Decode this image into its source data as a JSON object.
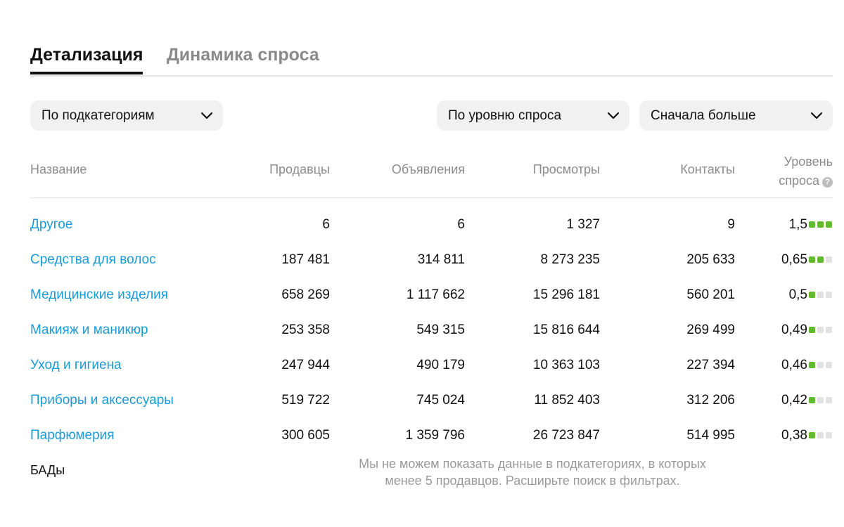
{
  "tabs": [
    {
      "label": "Детализация",
      "active": true
    },
    {
      "label": "Динамика спроса",
      "active": false
    }
  ],
  "filters": {
    "grouping": "По подкатегориям",
    "metric": "По уровню спроса",
    "sort": "Сначала больше"
  },
  "table": {
    "headers": {
      "name": "Название",
      "sellers": "Продавцы",
      "listings": "Объявления",
      "views": "Просмотры",
      "contacts": "Контакты",
      "level": "Уровень спроса"
    },
    "rows": [
      {
        "name": "Другое",
        "sellers": "6",
        "listings": "6",
        "views": "1 327",
        "contacts": "9",
        "level": "1,5",
        "level_dots": 3
      },
      {
        "name": "Средства для волос",
        "sellers": "187 481",
        "listings": "314 811",
        "views": "8 273 235",
        "contacts": "205 633",
        "level": "0,65",
        "level_dots": 2
      },
      {
        "name": "Медицинские изделия",
        "sellers": "658 269",
        "listings": "1 117 662",
        "views": "15 296 181",
        "contacts": "560 201",
        "level": "0,5",
        "level_dots": 1
      },
      {
        "name": "Макияж и маникюр",
        "sellers": "253 358",
        "listings": "549 315",
        "views": "15 816 644",
        "contacts": "269 499",
        "level": "0,49",
        "level_dots": 1
      },
      {
        "name": "Уход и гигиена",
        "sellers": "247 944",
        "listings": "490 179",
        "views": "10 363 103",
        "contacts": "227 394",
        "level": "0,46",
        "level_dots": 1
      },
      {
        "name": "Приборы и аксессуары",
        "sellers": "519 722",
        "listings": "745 024",
        "views": "11 852 403",
        "contacts": "312 206",
        "level": "0,42",
        "level_dots": 1
      },
      {
        "name": "Парфюмерия",
        "sellers": "300 605",
        "listings": "1 359 796",
        "views": "26 723 847",
        "contacts": "514 995",
        "level": "0,38",
        "level_dots": 1
      }
    ],
    "hidden_row": {
      "name": "БАДы",
      "notice": "Мы не можем показать данные в подкатегориях, в которых менее 5 продавцов. Расширьте поиск в фильтрах."
    }
  },
  "icons": {
    "dropdown": "chevron-down-icon",
    "help": "help-icon"
  },
  "colors": {
    "link": "#1a9ad6",
    "level_on": "#5fbb2b",
    "level_off": "#e2e2e2",
    "muted": "#8c8c8c"
  }
}
